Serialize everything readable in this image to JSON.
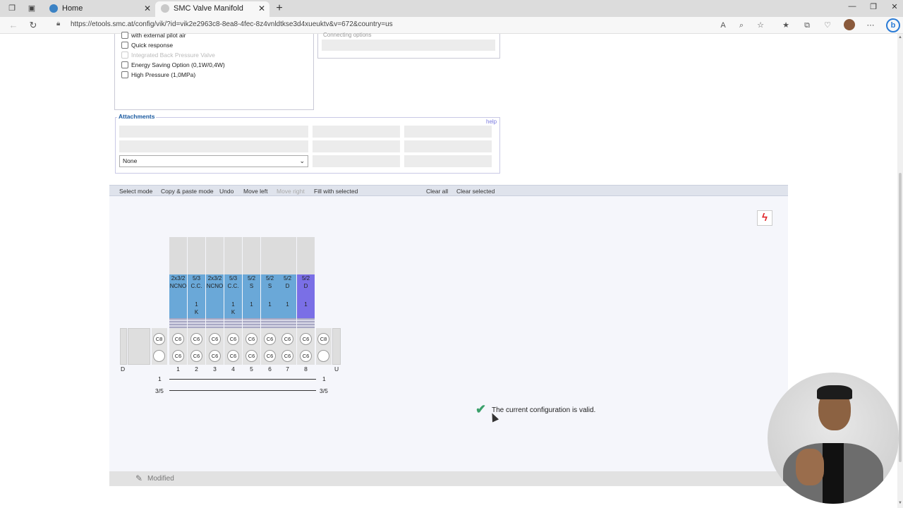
{
  "browser": {
    "tabs": [
      {
        "title": "Home",
        "active": false
      },
      {
        "title": "SMC Valve Manifold Configurati",
        "active": true
      }
    ],
    "url": "https://etools.smc.at/config/vik/?id=vik2e2963c8-8ea8-4fec-8z4vnldtkse3d4xueuktv&v=672&country=us"
  },
  "options": {
    "partial_top": "with external pilot air",
    "items": [
      {
        "label": "Quick response",
        "disabled": false
      },
      {
        "label": "Integrated Back Pressure Valve",
        "disabled": true
      },
      {
        "label": "Energy Saving Option (0,1W/0,4W)",
        "disabled": false
      },
      {
        "label": "High Pressure (1,0MPa)",
        "disabled": false
      }
    ]
  },
  "connecting": {
    "label": "Connecting options"
  },
  "attachments": {
    "title": "Attachments",
    "help": "help",
    "select_value": "None"
  },
  "toolbar": {
    "select_mode": "Select mode",
    "copy_paste": "Copy & paste mode",
    "undo": "Undo",
    "move_left": "Move left",
    "move_right": "Move right",
    "fill_selected": "Fill with selected",
    "clear_all": "Clear all",
    "clear_selected": "Clear selected"
  },
  "manifold": {
    "left_end": "D",
    "right_end": "U",
    "stations": [
      {
        "num": "1",
        "l1": "2x3/2",
        "l2": "NCNO",
        "l3": "",
        "l4": "",
        "selected": false
      },
      {
        "num": "2",
        "l1": "5/3",
        "l2": "C.C.",
        "l3": "1",
        "l4": "K",
        "selected": false
      },
      {
        "num": "3",
        "l1": "2x3/2",
        "l2": "NCNO",
        "l3": "",
        "l4": "",
        "selected": false
      },
      {
        "num": "4",
        "l1": "5/3",
        "l2": "C.C.",
        "l3": "1",
        "l4": "K",
        "selected": false
      },
      {
        "num": "5",
        "l1": "5/2",
        "l2": "S",
        "l3": "1",
        "l4": "",
        "selected": false
      },
      {
        "num": "6",
        "l1": "5/2",
        "l2": "S",
        "l3": "1",
        "l4": "",
        "selected": false
      },
      {
        "num": "7",
        "l1": "5/2",
        "l2": "D",
        "l3": "1",
        "l4": "",
        "selected": false
      },
      {
        "num": "8",
        "l1": "5/2",
        "l2": "D",
        "l3": "1",
        "l4": "",
        "selected": true
      }
    ],
    "port_top": "C6",
    "port_bottom": "C6",
    "end_port_top": "C8",
    "supply_label": "1",
    "exhaust_label": "3/5"
  },
  "status": {
    "valid_message": "The current configuration is valid.",
    "modified": "Modified"
  },
  "colors": {
    "valve": "#6aa8d8",
    "valve_selected": "#7a6fe6",
    "toolbar": "#dfe3ec",
    "valid_check": "#3aa06a"
  }
}
